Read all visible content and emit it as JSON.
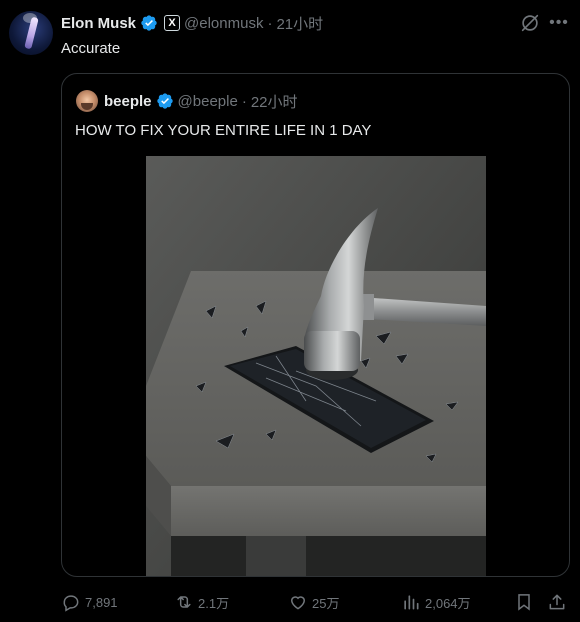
{
  "tweet": {
    "author_name": "Elon Musk",
    "author_handle": "@elonmusk",
    "separator": "·",
    "time": "21小时",
    "text": "Accurate",
    "badge_letter": "X"
  },
  "quote": {
    "author_name": "beeple",
    "author_handle": "@beeple",
    "separator": "·",
    "time": "22小时",
    "text": "HOW TO FIX YOUR ENTIRE LIFE IN 1 DAY",
    "media_description": "hammer-smashing-phone-image"
  },
  "actions": {
    "replies": "7,891",
    "reposts": "2.1万",
    "likes": "25万",
    "views": "2,064万"
  },
  "colors": {
    "background": "#000000",
    "text": "#e7e9ea",
    "muted": "#71767b",
    "border": "#2f3336",
    "verified": "#1d9bf0"
  }
}
